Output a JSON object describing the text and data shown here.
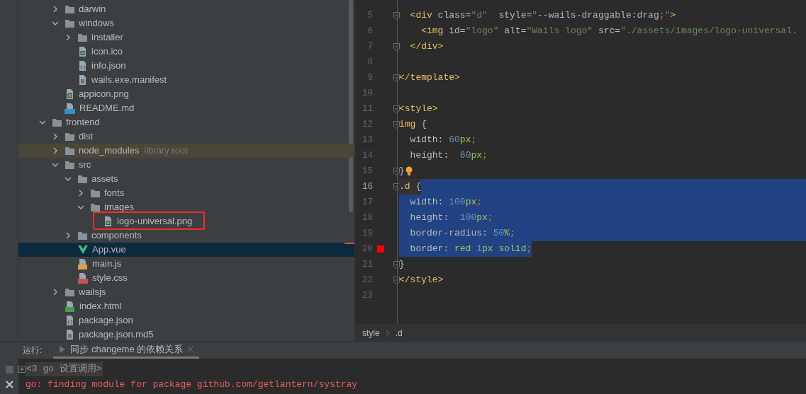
{
  "project_tree": [
    {
      "children": [
        {
          "label": "darwin",
          "kind": "folder",
          "expanded": false,
          "selected": false
        },
        {
          "label": "windows",
          "kind": "folder",
          "expanded": true,
          "selected": false,
          "children": [
            {
              "label": "installer",
              "kind": "folder",
              "expanded": false,
              "selected": false
            },
            {
              "label": "icon.ico",
              "kind": "image",
              "selected": false
            },
            {
              "label": "info.json",
              "kind": "json",
              "selected": false
            },
            {
              "label": "wails.exe.manifest",
              "kind": "text",
              "selected": false
            }
          ]
        },
        {
          "label": "appicon.png",
          "kind": "image",
          "selected": false
        },
        {
          "label": "README.md",
          "kind": "md",
          "selected": false
        }
      ]
    },
    {
      "label": "frontend",
      "kind": "folder",
      "expanded": true,
      "selected": false,
      "children": [
        {
          "label": "dist",
          "kind": "folder",
          "expanded": false,
          "selected": false
        },
        {
          "label": "node_modules",
          "hint": "library root",
          "library": true,
          "kind": "folder",
          "expanded": false,
          "selected": false
        },
        {
          "label": "src",
          "kind": "folder",
          "expanded": true,
          "selected": false,
          "children": [
            {
              "label": "assets",
              "kind": "folder",
              "expanded": true,
              "selected": false,
              "children": [
                {
                  "label": "fonts",
                  "kind": "folder",
                  "expanded": false,
                  "selected": false
                },
                {
                  "label": "images",
                  "kind": "folder",
                  "expanded": true,
                  "selected": false,
                  "children": [
                    {
                      "label": "logo-universal.png",
                      "kind": "image",
                      "selected": false,
                      "marked": true
                    }
                  ]
                }
              ]
            },
            {
              "label": "components",
              "kind": "folder",
              "expanded": false,
              "selected": false
            },
            {
              "label": "App.vue",
              "kind": "vue",
              "selected": true
            },
            {
              "label": "main.js",
              "kind": "js",
              "selected": false
            },
            {
              "label": "style.css",
              "kind": "css",
              "selected": false
            }
          ]
        },
        {
          "label": "wailsjs",
          "kind": "folder",
          "expanded": false,
          "selected": false
        },
        {
          "label": "index.html",
          "kind": "html",
          "selected": false
        },
        {
          "label": "package.json",
          "kind": "json",
          "selected": false
        },
        {
          "label": "package.json.md5",
          "kind": "text",
          "selected": false
        }
      ]
    }
  ],
  "editor": {
    "lines": [
      {
        "number": "5",
        "fold": true,
        "current": false,
        "selected": false,
        "tokens": [
          {
            "kind": "tag",
            "text": "  <div"
          },
          {
            "kind": "attr",
            "text": " class="
          },
          {
            "kind": "string",
            "text": "\"d\""
          },
          {
            "kind": "attr",
            "text": "  style="
          },
          {
            "kind": "string",
            "text": "\""
          },
          {
            "kind": "plain",
            "text": "--wails-draggable:drag"
          },
          {
            "kind": "punct",
            "text": ";"
          },
          {
            "kind": "string",
            "text": "\""
          },
          {
            "kind": "tag",
            "text": ">"
          }
        ]
      },
      {
        "number": "6",
        "fold": false,
        "current": false,
        "selected": false,
        "tokens": [
          {
            "kind": "tag",
            "text": "    <img"
          },
          {
            "kind": "attr",
            "text": " id="
          },
          {
            "kind": "string",
            "text": "\"logo\""
          },
          {
            "kind": "attr",
            "text": " alt="
          },
          {
            "kind": "string",
            "text": "\"Wails logo\""
          },
          {
            "kind": "attr",
            "text": " src="
          },
          {
            "kind": "string",
            "text": "\"./assets/images/logo-universal."
          }
        ]
      },
      {
        "number": "7",
        "fold": true,
        "current": false,
        "selected": false,
        "tokens": [
          {
            "kind": "tag",
            "text": "  </div>"
          }
        ]
      },
      {
        "number": "8",
        "fold": false,
        "current": false,
        "selected": false
      },
      {
        "number": "9",
        "fold": true,
        "current": false,
        "selected": false,
        "tokens": [
          {
            "kind": "tag",
            "text": "</template>"
          }
        ]
      },
      {
        "number": "10",
        "fold": false,
        "current": false,
        "selected": false
      },
      {
        "number": "11",
        "fold": true,
        "current": false,
        "selected": false,
        "tokens": [
          {
            "kind": "tag",
            "text": "<style>"
          }
        ]
      },
      {
        "number": "12",
        "fold": true,
        "current": false,
        "selected": false,
        "tokens": [
          {
            "kind": "tag",
            "text": "img"
          },
          {
            "kind": "plain",
            "text": " {"
          }
        ]
      },
      {
        "number": "13",
        "fold": false,
        "current": false,
        "selected": false,
        "tokens": [
          {
            "kind": "attr",
            "text": "  width: "
          },
          {
            "kind": "number",
            "text": "60"
          },
          {
            "kind": "unit",
            "text": "px"
          },
          {
            "kind": "punct",
            "text": ";"
          }
        ]
      },
      {
        "number": "14",
        "fold": false,
        "current": false,
        "selected": false,
        "tokens": [
          {
            "kind": "attr",
            "text": "  height:  "
          },
          {
            "kind": "number",
            "text": "60"
          },
          {
            "kind": "unit",
            "text": "px"
          },
          {
            "kind": "punct",
            "text": ";"
          }
        ]
      },
      {
        "number": "15",
        "fold": true,
        "bulb": true,
        "current": false,
        "selected": false,
        "tokens": [
          {
            "kind": "plain",
            "text": "}"
          }
        ]
      },
      {
        "number": "16",
        "fold": true,
        "current": true,
        "selected": true,
        "tokens": [
          {
            "kind": "tag",
            "text": ".d"
          },
          {
            "kind": "plain",
            "text": " {"
          }
        ]
      },
      {
        "number": "17",
        "fold": false,
        "current": false,
        "selected": true,
        "tokens": [
          {
            "kind": "attr",
            "text": "  width: "
          },
          {
            "kind": "number",
            "text": "100"
          },
          {
            "kind": "unit",
            "text": "px"
          },
          {
            "kind": "punct",
            "text": ";"
          }
        ]
      },
      {
        "number": "18",
        "fold": false,
        "current": false,
        "selected": true,
        "tokens": [
          {
            "kind": "attr",
            "text": "  height:  "
          },
          {
            "kind": "number",
            "text": "100"
          },
          {
            "kind": "unit",
            "text": "px"
          },
          {
            "kind": "punct",
            "text": ";"
          }
        ]
      },
      {
        "number": "19",
        "fold": false,
        "current": false,
        "selected": true,
        "tokens": [
          {
            "kind": "attr",
            "text": "  border-radius: "
          },
          {
            "kind": "number",
            "text": "50"
          },
          {
            "kind": "unit",
            "text": "%"
          },
          {
            "kind": "punct",
            "text": ";"
          }
        ]
      },
      {
        "number": "20",
        "fold": false,
        "breakpoint": true,
        "current": false,
        "selected": true,
        "tokens": [
          {
            "kind": "attr",
            "text": "  border: "
          },
          {
            "kind": "unit",
            "text": "red "
          },
          {
            "kind": "number",
            "text": "1"
          },
          {
            "kind": "unit",
            "text": "px solid"
          },
          {
            "kind": "punct",
            "text": ";"
          }
        ]
      },
      {
        "number": "21",
        "fold": true,
        "current": false,
        "selected": false,
        "tokens": [
          {
            "kind": "plain",
            "text": "}"
          }
        ]
      },
      {
        "number": "22",
        "fold": true,
        "current": false,
        "selected": false,
        "tokens": [
          {
            "kind": "tag",
            "text": "</style>"
          }
        ]
      },
      {
        "number": "23",
        "fold": false,
        "current": false,
        "selected": false
      }
    ],
    "breadcrumbs": [
      "style",
      ".d"
    ]
  },
  "run_panel": {
    "label": "运行:",
    "tabs": [
      {
        "label": "同步 changeme 的依赖关系",
        "selected": true
      }
    ],
    "output": [
      {
        "kind": "folded",
        "text": "<3 go 设置调用>"
      },
      {
        "kind": "error",
        "text": "go: finding module for package github.com/getlantern/systray"
      }
    ]
  }
}
